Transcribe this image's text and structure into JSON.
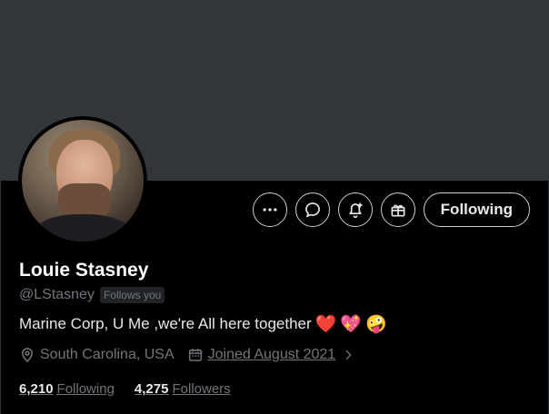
{
  "profile": {
    "display_name": "Louie Stasney",
    "handle": "@LStasney",
    "follows_you": "Follows you",
    "bio_text": "Marine Corp, U Me ,we're All here together",
    "bio_emojis": [
      "❤️",
      "💖",
      "🤪"
    ],
    "location": "South Carolina, USA",
    "joined": "Joined August 2021",
    "following_count": "6,210",
    "following_label": "Following",
    "followers_count": "4,275",
    "followers_label": "Followers"
  },
  "actions": {
    "more_icon": "more-dots-icon",
    "message_icon": "message-bubble-icon",
    "notify_icon": "bell-plus-icon",
    "gift_icon": "gift-icon",
    "follow_label": "Following"
  },
  "colors": {
    "background": "#000000",
    "banner": "#333639",
    "text_primary": "#e7e9ea",
    "text_secondary": "#71767b"
  }
}
